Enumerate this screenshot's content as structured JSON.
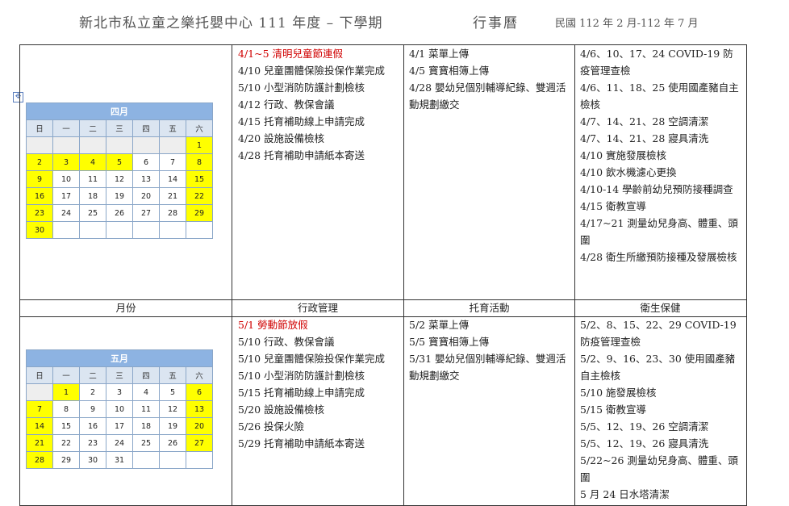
{
  "header": {
    "title": "新北市私立童之樂托嬰中心 111 年度 – 下學期",
    "calendar_label": "行事曆",
    "range": "民國 112 年 2 月-112 年 7 月"
  },
  "columns": {
    "month": "月份",
    "admin": "行政管理",
    "childcare": "托育活動",
    "health": "衛生保健"
  },
  "april": {
    "calendar": {
      "title": "四月",
      "weekdays": [
        "日",
        "一",
        "二",
        "三",
        "四",
        "五",
        "六"
      ],
      "weeks": [
        [
          "",
          "",
          "",
          "",
          "",
          "",
          "1"
        ],
        [
          "2",
          "3",
          "4",
          "5",
          "6",
          "7",
          "8"
        ],
        [
          "9",
          "10",
          "11",
          "12",
          "13",
          "14",
          "15"
        ],
        [
          "16",
          "17",
          "18",
          "19",
          "20",
          "21",
          "22"
        ],
        [
          "23",
          "24",
          "25",
          "26",
          "27",
          "28",
          "29"
        ],
        [
          "30",
          "",
          "",
          "",
          "",
          "",
          ""
        ]
      ],
      "holidays": [
        "1",
        "2",
        "3",
        "4",
        "5",
        "8",
        "9",
        "15",
        "16",
        "22",
        "23",
        "29",
        "30"
      ]
    },
    "admin": [
      {
        "text": "4/1~5 清明兒童節連假",
        "highlight": true
      },
      {
        "text": "4/10 兒童團體保險投保作業完成"
      },
      {
        "text": "5/10 小型消防防護計劃檢核"
      },
      {
        "text": "4/12 行政、教保會議"
      },
      {
        "text": "4/15 托育補助線上申請完成"
      },
      {
        "text": "4/20 設施設備檢核"
      },
      {
        "text": "4/28 托育補助申請紙本寄送"
      }
    ],
    "childcare": [
      "4/1 菜單上傳",
      "4/5 寶寶相簿上傳",
      "4/28 嬰幼兒個別輔導紀錄、雙週活動規劃繳交"
    ],
    "health": [
      "4/6、10、17、24 COVID-19 防疫管理查檢",
      "4/6、11、18、25 使用國產豬自主檢核",
      "4/7、14、21、28 空調清潔",
      "4/7、14、21、28 寢具清洗",
      "4/10 實施發展檢核",
      "4/10 飲水機濾心更換",
      "4/10-14 學齡前幼兒預防接種調查",
      "4/15 衛教宣導",
      "4/17~21 測量幼兒身高、體重、頭圍",
      "4/28 衛生所繳預防接種及發展檢核"
    ]
  },
  "may": {
    "calendar": {
      "title": "五月",
      "weekdays": [
        "日",
        "一",
        "二",
        "三",
        "四",
        "五",
        "六"
      ],
      "weeks": [
        [
          "",
          "1",
          "2",
          "3",
          "4",
          "5",
          "6"
        ],
        [
          "7",
          "8",
          "9",
          "10",
          "11",
          "12",
          "13"
        ],
        [
          "14",
          "15",
          "16",
          "17",
          "18",
          "19",
          "20"
        ],
        [
          "21",
          "22",
          "23",
          "24",
          "25",
          "26",
          "27"
        ],
        [
          "28",
          "29",
          "30",
          "31",
          "",
          "",
          ""
        ]
      ],
      "holidays": [
        "1",
        "6",
        "7",
        "13",
        "14",
        "20",
        "21",
        "27",
        "28"
      ]
    },
    "admin": [
      {
        "text": "5/1 勞動節放假",
        "highlight": true
      },
      {
        "text": "5/10 行政、教保會議"
      },
      {
        "text": "5/10 兒童團體保險投保作業完成"
      },
      {
        "text": "5/10 小型消防防護計劃檢核"
      },
      {
        "text": "5/15 托育補助線上申請完成"
      },
      {
        "text": "5/20 設施設備檢核"
      },
      {
        "text": "5/26 投保火險"
      },
      {
        "text": "5/29 托育補助申請紙本寄送"
      }
    ],
    "childcare": [
      "5/2 菜單上傳",
      "5/5 寶寶相簿上傳",
      "5/31 嬰幼兒個別輔導紀錄、雙週活動規劃繳交"
    ],
    "health": [
      "5/2、8、15、22、29 COVID-19 防疫管理查檢",
      "5/2、9、16、23、30 使用國產豬自主檢核",
      "5/10 施發展檢核",
      "5/15 衛教宣導",
      "5/5、12、19、26 空調清潔",
      "5/5、12、19、26 寢具清洗",
      "5/22~26 測量幼兒身高、體重、頭圍",
      "5 月 24 日水塔清潔"
    ]
  }
}
